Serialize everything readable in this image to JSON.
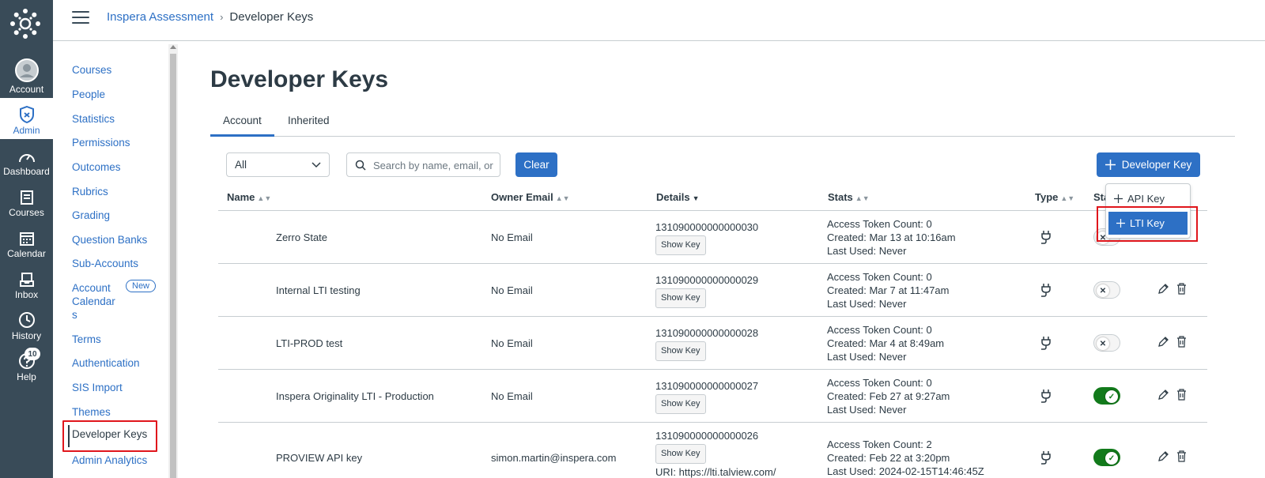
{
  "global_nav": {
    "items": [
      {
        "label": "Account",
        "icon": "avatar-icon"
      },
      {
        "label": "Admin",
        "icon": "shield-icon"
      },
      {
        "label": "Dashboard",
        "icon": "dashboard-icon"
      },
      {
        "label": "Courses",
        "icon": "courses-icon"
      },
      {
        "label": "Calendar",
        "icon": "calendar-icon"
      },
      {
        "label": "Inbox",
        "icon": "inbox-icon"
      },
      {
        "label": "History",
        "icon": "clock-icon"
      },
      {
        "label": "Help",
        "icon": "help-icon",
        "badge": "10"
      }
    ]
  },
  "breadcrumb": {
    "root": "Inspera Assessment",
    "separator": "›",
    "current": "Developer Keys"
  },
  "subnav": {
    "items": [
      "Courses",
      "People",
      "Statistics",
      "Permissions",
      "Outcomes",
      "Rubrics",
      "Grading",
      "Question Banks",
      "Sub-Accounts"
    ],
    "account_calendars_line1": "Account",
    "account_calendars_line2": "Calendar",
    "account_calendars_line3": "s",
    "new_badge": "New",
    "items_after": [
      "Terms",
      "Authentication",
      "SIS Import",
      "Themes"
    ],
    "active": "Developer Keys",
    "last": "Admin Analytics"
  },
  "page": {
    "title": "Developer Keys",
    "tabs": [
      "Account",
      "Inherited"
    ],
    "active_tab": "Account"
  },
  "filters": {
    "select_value": "All",
    "search_placeholder": "Search by name, email, or ID",
    "clear_label": "Clear",
    "add_key_label": "Developer Key"
  },
  "add_menu": {
    "items": [
      "API Key",
      "LTI Key"
    ],
    "highlighted": "LTI Key"
  },
  "table": {
    "headers": {
      "name": "Name",
      "owner": "Owner Email",
      "details": "Details",
      "stats": "Stats",
      "type": "Type",
      "state": "Sta"
    },
    "show_key_label": "Show Key",
    "rows": [
      {
        "name": "Zerro State",
        "owner": "No Email",
        "id": "131090000000000030",
        "stats": [
          "Access Token Count: 0",
          "Created: Mar 13 at 10:16am",
          "Last Used: Never"
        ],
        "type": "lti-plug-icon",
        "enabled": false
      },
      {
        "name": "Internal LTI testing",
        "owner": "No Email",
        "id": "131090000000000029",
        "stats": [
          "Access Token Count: 0",
          "Created: Mar 7 at 11:47am",
          "Last Used: Never"
        ],
        "type": "lti-plug-icon",
        "enabled": false
      },
      {
        "name": "LTI-PROD test",
        "owner": "No Email",
        "id": "131090000000000028",
        "stats": [
          "Access Token Count: 0",
          "Created: Mar 4 at 8:49am",
          "Last Used: Never"
        ],
        "type": "lti-plug-icon",
        "enabled": false
      },
      {
        "name": "Inspera Originality LTI - Production",
        "owner": "No Email",
        "id": "131090000000000027",
        "stats": [
          "Access Token Count: 0",
          "Created: Feb 27 at 9:27am",
          "Last Used: Never"
        ],
        "type": "lti-plug-icon",
        "enabled": true
      },
      {
        "name": "PROVIEW API key",
        "owner": "simon.martin@inspera.com",
        "id": "131090000000000026",
        "uri": "URI: https://lti.talview.com/",
        "stats": [
          "Access Token Count: 2",
          "Created: Feb 22 at 3:20pm",
          "Last Used: 2024-02-15T14:46:45Z"
        ],
        "type": "lti-plug-icon",
        "enabled": true
      }
    ]
  },
  "colors": {
    "nav_bg": "#394b58",
    "brand": "#2d70c5",
    "highlight": "#e0161c",
    "enabled": "#127a1b"
  }
}
